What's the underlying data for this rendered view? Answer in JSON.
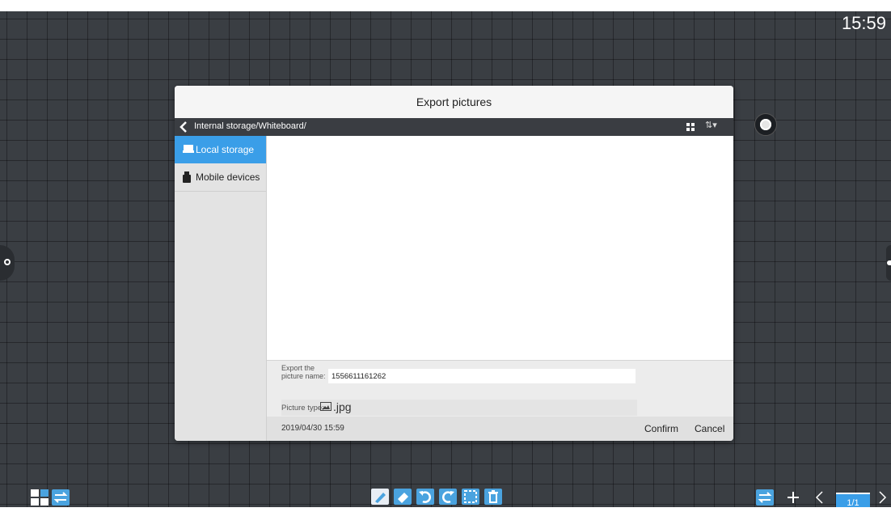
{
  "clock": "15:59",
  "dialog": {
    "title": "Export pictures",
    "path": "Internal storage/Whiteboard/",
    "sidebar": [
      {
        "label": "Local storage",
        "icon": "drive-icon",
        "active": true
      },
      {
        "label": "Mobile devices",
        "icon": "usb-icon",
        "active": false
      }
    ],
    "form": {
      "name_label": "Export the picture name:",
      "name_value": "1556611161262",
      "type_label": "Picture type:",
      "type_value": ".jpg"
    },
    "footer": {
      "timestamp": "2019/04/30 15:59",
      "confirm_label": "Confirm",
      "cancel_label": "Cancel"
    }
  },
  "toolbar": {
    "left_icons": [
      "grid-view-icon",
      "switch-icon"
    ],
    "center_tools": [
      "pen-icon",
      "eraser-icon",
      "undo-icon",
      "redo-icon",
      "select-icon",
      "delete-icon"
    ],
    "right_icons": [
      "switch-icon",
      "add-page-icon",
      "prev-page-icon",
      "next-page-icon"
    ],
    "page_indicator": "1/1"
  },
  "colors": {
    "accent": "#3a9ee8",
    "canvas": "#3a3e43",
    "pathbar": "#3a3d42"
  }
}
